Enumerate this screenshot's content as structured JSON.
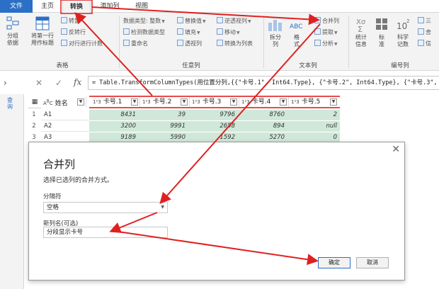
{
  "tabs": {
    "file": "文件",
    "home": "主页",
    "transform": "转换",
    "addcol": "添加列",
    "view": "视图"
  },
  "ribbon": {
    "table_group": "表格",
    "any_col_group": "任意列",
    "text_col_group": "文本列",
    "num_col_group": "编号列",
    "group_by": "分组\n依据",
    "first_row": "将第一行\n用作标题",
    "transpose": "转置",
    "reverse_rows": "反转行",
    "count_rows": "对行进行计数",
    "data_type": "数据类型: 整数",
    "detect_type": "检测数据类型",
    "rename": "重命名",
    "replace": "替换值",
    "fill": "填充",
    "pivot": "透视列",
    "unpivot": "逆透视列",
    "move": "移动",
    "to_list": "转换为列表",
    "split": "拆分\n列",
    "format": "格\n式",
    "merge_cols": "合并列",
    "extract": "提取",
    "parse": "分析",
    "stats": "统计\n信息",
    "standard": "标\n准",
    "scientific": "科学\n记数",
    "trig": "三",
    "round": "舍",
    "info": "信"
  },
  "formula": {
    "text": "= Table.TransformColumnTypes(用位置分列,{{\"卡号.1\", Int64.Type}, {\"卡号.2\", Int64.Type}, {\"卡号.3\","
  },
  "side_panel_label": "查询",
  "table": {
    "headers": [
      {
        "type": "A B C",
        "name": "姓名"
      },
      {
        "type": "1 2 3",
        "name": "卡号.1"
      },
      {
        "type": "1 2 3",
        "name": "卡号.2"
      },
      {
        "type": "1 2 3",
        "name": "卡号.3"
      },
      {
        "type": "1 2 3",
        "name": "卡号.4"
      },
      {
        "type": "1 2 3",
        "name": "卡号.5"
      }
    ],
    "rows": [
      {
        "n": "1",
        "name": "A1",
        "v": [
          "8431",
          "39",
          "9796",
          "8760",
          "2"
        ]
      },
      {
        "n": "2",
        "name": "A2",
        "v": [
          "3200",
          "9991",
          "2658",
          "894",
          "null"
        ]
      },
      {
        "n": "3",
        "name": "A3",
        "v": [
          "9189",
          "5990",
          "1592",
          "5270",
          "0"
        ]
      }
    ]
  },
  "dialog": {
    "title": "合并列",
    "description": "选择已选列的合并方式。",
    "separator_label": "分隔符",
    "separator_value": "空格",
    "new_col_label": "新列名(可选)",
    "new_col_value": "分段显示卡号",
    "ok": "确定",
    "cancel": "取消"
  },
  "colors": {
    "accent": "#2b6fc6",
    "arrow": "#e02020",
    "num_cell": "#cfe8d9"
  }
}
